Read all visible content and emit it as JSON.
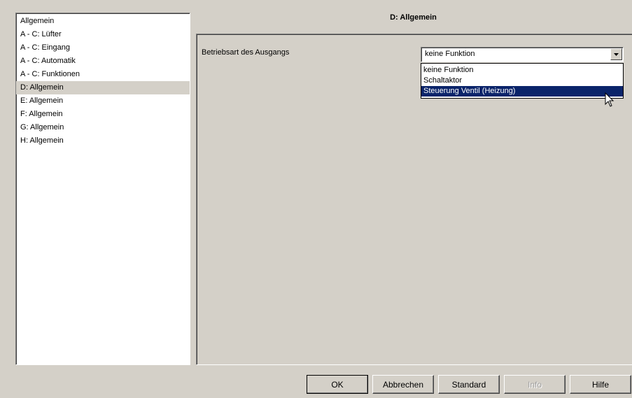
{
  "nav": {
    "items": [
      {
        "label": "Allgemein"
      },
      {
        "label": "A - C: Lüfter"
      },
      {
        "label": "A - C: Eingang"
      },
      {
        "label": "A - C: Automatik"
      },
      {
        "label": "A - C: Funktionen"
      },
      {
        "label": "D: Allgemein"
      },
      {
        "label": "E: Allgemein"
      },
      {
        "label": "F: Allgemein"
      },
      {
        "label": "G: Allgemein"
      },
      {
        "label": "H: Allgemein"
      }
    ],
    "selected": "D: Allgemein"
  },
  "page": {
    "title": "D: Allgemein",
    "param_label": "Betriebsart des Ausgangs",
    "combo_value": "keine Funktion",
    "dropdown_options": [
      {
        "label": "keine Funktion"
      },
      {
        "label": "Schaltaktor"
      },
      {
        "label": "Steuerung Ventil (Heizung)"
      }
    ],
    "dropdown_highlighted": "Steuerung Ventil (Heizung)"
  },
  "buttons": {
    "ok": "OK",
    "cancel": "Abbrechen",
    "standard": "Standard",
    "info": "Info",
    "help": "Hilfe"
  },
  "colors": {
    "window_bg": "#d4d0c8",
    "highlight": "#0a246a"
  },
  "icons": {
    "combo_arrow": "chevron-down-icon",
    "cursor": "mouse-pointer-icon"
  }
}
